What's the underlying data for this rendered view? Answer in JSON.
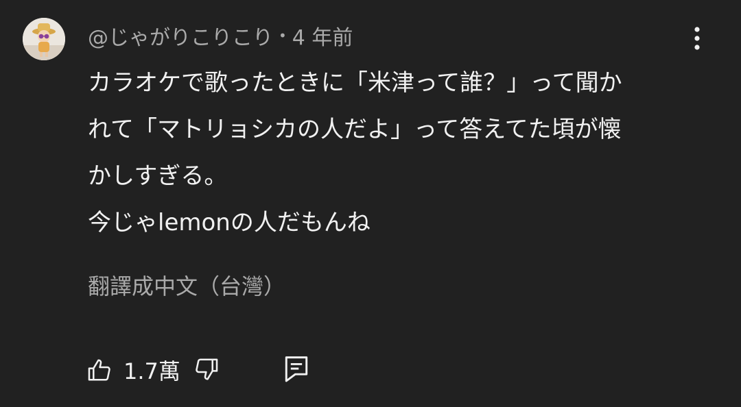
{
  "comment": {
    "author": "@じゃがりこりこり",
    "separator": "•",
    "time": "4 年前",
    "lines": [
      "カラオケで歌ったときに「米津って誰？」って聞か",
      "れて「マトリョシカの人だよ」って答えてた頃が懐",
      "かしすぎる。",
      "今じゃlemonの人だもんね"
    ],
    "translate_label": "翻譯成中文（台灣）",
    "like_count": "1.7萬"
  },
  "icons": {
    "menu": "more-vert-icon",
    "like": "thumb-up-icon",
    "dislike": "thumb-down-icon",
    "reply": "comment-icon"
  },
  "colors": {
    "background": "#212121",
    "primary_text": "#f1f1f1",
    "secondary_text": "#aaaaaa"
  }
}
